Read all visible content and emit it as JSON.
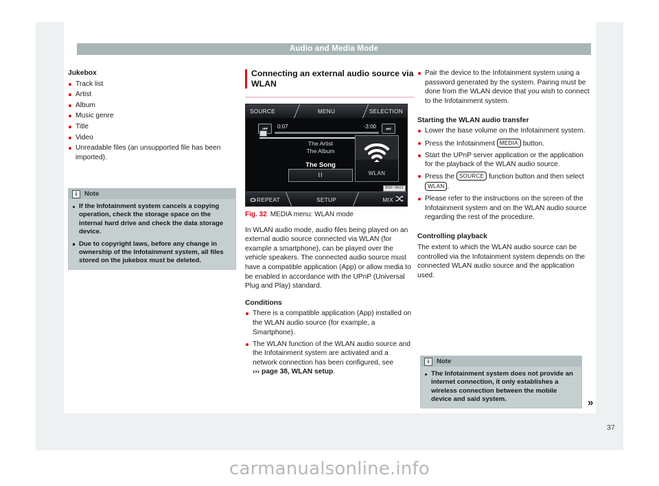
{
  "header": {
    "title": "Audio and Media Mode"
  },
  "page": {
    "number": "37",
    "watermark": "carmanualsonline.info",
    "turn_marker": "»"
  },
  "left_column": {
    "heading": "Jukebox",
    "items": [
      "Track list",
      "Artist",
      "Album",
      "Music genre",
      "Title",
      "Video",
      "Unreadable files (an unsupported file has been imported)."
    ],
    "note": {
      "icon": "info-icon",
      "title": "Note",
      "bullets": [
        "If the Infotainment system cancels a copying operation, check the storage space on the internal hard drive and check the data storage device.",
        "Due to copyright laws, before any change in ownership of the Infotainment system, all files stored on the jukebox must be deleted."
      ]
    }
  },
  "middle_column": {
    "heading": "Connecting an external audio source via WLAN",
    "figure": {
      "top_bar": {
        "left": "SOURCE",
        "center": "MENU",
        "right": "SELECTION"
      },
      "player": {
        "prev_icon": "skip-previous-icon",
        "next_icon": "skip-next-icon",
        "current_time": "0:07",
        "remaining_time": "-3:00",
        "artist": "The Artist",
        "album": "The Album",
        "song": "The Song",
        "pause_label": "II",
        "tile_icon": "wifi-icon",
        "tile_label": "WLAN"
      },
      "bottom_bar": {
        "left": "REPEAT",
        "center": "SETUP",
        "right": "MIX"
      },
      "code": "BSF-0601"
    },
    "caption": {
      "number": "Fig. 32",
      "text": "MEDIA menu: WLAN mode"
    },
    "body": "In WLAN audio mode, audio files being played on an external audio source connected via WLAN (for example a smartphone), can be played over the vehicle speakers. The connected audio source must have a compatible application (App) or allow media to be enabled in accordance with the UPnP (Universal Plug and Play) standard.",
    "conditions_heading": "Conditions",
    "conditions": [
      "There is a compatible application (App) installed on the WLAN audio source (for example, a Smartphone).",
      "The WLAN function of the WLAN audio source and the Infotainment system are activated and a network connection has been configured, see"
    ],
    "condition_2_ref": "››› page 38, WLAN setup",
    "condition_2_tail": "."
  },
  "right_column": {
    "pair_bullet": "Pair the device to the Infotainment system using a password generated by the system. Pairing must be done from the WLAN device that you wish to connect to the Infotainment system.",
    "starting_heading": "Starting the WLAN audio transfer",
    "step_1": "Lower the base volume on the Infotainment system.",
    "step_2_pre": "Press the Infotainment",
    "step_2_key": "MEDIA",
    "step_2_post": "button.",
    "step_3": "Start the UPnP server application or the application for the playback of the WLAN audio source.",
    "step_4_pre": "Press the",
    "step_4_key": "SOURCE",
    "step_4_mid": "function button and then select",
    "step_4_key2": "WLAN",
    "step_4_post": ".",
    "step_5": "Please refer to the instructions on the screen of the Infotainment system and on the WLAN audio source regarding the rest of the procedure.",
    "controlling_heading": "Controlling playback",
    "controlling_body": "The extent to which the WLAN audio source can be controlled via the Infotainment system depends on the connected WLAN audio source and the application used.",
    "note": {
      "icon": "info-icon",
      "title": "Note",
      "bullets": [
        "The Infotainment system does not provide an internet connection, it only establishes a wireless connection between the mobile device and said system."
      ]
    }
  }
}
